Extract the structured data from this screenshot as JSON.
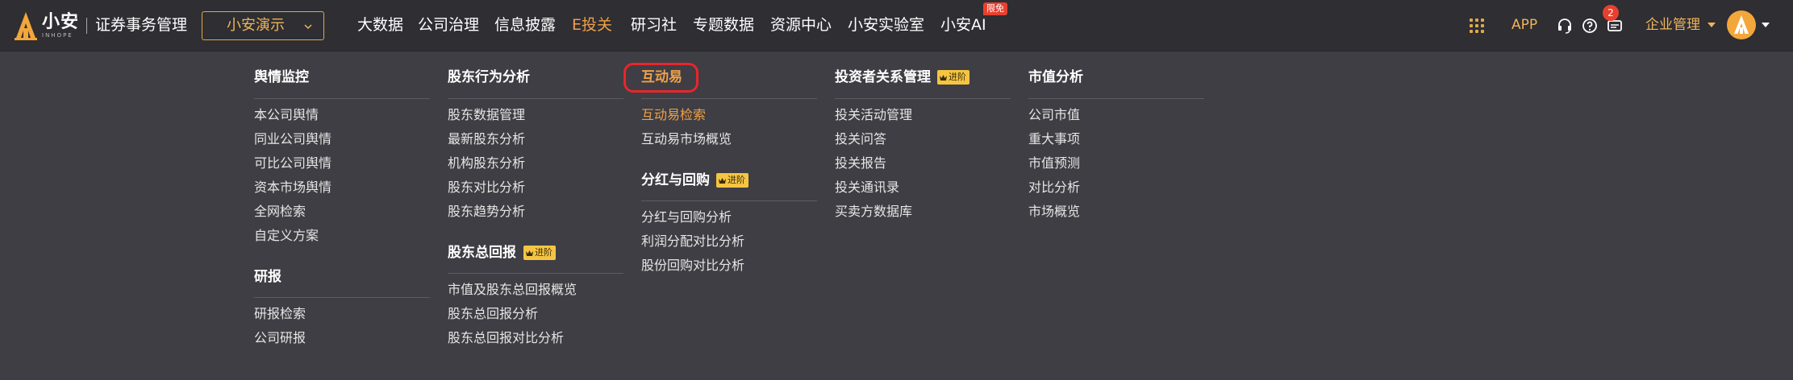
{
  "header": {
    "brand_cn": "小安",
    "brand_en": "INHOPE",
    "system_name": "证券事务管理",
    "company_select": "小安演示",
    "nav": [
      {
        "label": "大数据",
        "active": false
      },
      {
        "label": "公司治理",
        "active": false
      },
      {
        "label": "信息披露",
        "active": false
      },
      {
        "label": "E投关",
        "active": true
      },
      {
        "label": "研习社",
        "active": false
      },
      {
        "label": "专题数据",
        "active": false
      },
      {
        "label": "资源中心",
        "active": false
      },
      {
        "label": "小安实验室",
        "active": false
      },
      {
        "label": "小安AI",
        "active": false
      }
    ],
    "ai_badge": "限免",
    "app_label": "APP",
    "icons": [
      "apps-grid-icon",
      "headset-icon",
      "help-icon",
      "message-icon"
    ],
    "message_count": "2",
    "enterprise_label": "企业管理"
  },
  "menu": {
    "badge_label": "进阶",
    "col1": {
      "sections": [
        {
          "title": "舆情监控",
          "items": [
            "本公司舆情",
            "同业公司舆情",
            "可比公司舆情",
            "资本市场舆情",
            "全网检索",
            "自定义方案"
          ]
        },
        {
          "title": "研报",
          "items": [
            "研报检索",
            "公司研报"
          ]
        }
      ]
    },
    "col2": {
      "sections": [
        {
          "title": "股东行为分析",
          "items": [
            "股东数据管理",
            "最新股东分析",
            "机构股东分析",
            "股东对比分析",
            "股东趋势分析"
          ]
        },
        {
          "title": "股东总回报",
          "items": [
            "市值及股东总回报概览",
            "股东总回报分析",
            "股东总回报对比分析"
          ]
        }
      ]
    },
    "col3": {
      "sections": [
        {
          "title": "互动易",
          "items": [
            "互动易检索",
            "互动易市场概览"
          ]
        },
        {
          "title": "分红与回购",
          "items": [
            "分红与回购分析",
            "利润分配对比分析",
            "股份回购对比分析"
          ]
        }
      ]
    },
    "col4": {
      "sections": [
        {
          "title": "投资者关系管理",
          "items": [
            "投关活动管理",
            "投关问答",
            "投关报告",
            "投关通讯录",
            "买卖方数据库"
          ]
        }
      ]
    },
    "col5": {
      "sections": [
        {
          "title": "市值分析",
          "items": [
            "公司市值",
            "重大事项",
            "市值预测",
            "对比分析",
            "市场概览"
          ]
        }
      ]
    }
  },
  "colors": {
    "accent": "#f0a048",
    "badge_yellow": "#f5c542",
    "badge_red": "#e8402f",
    "highlight_ring": "#e8262a",
    "topbar_bg": "#2e2e33",
    "menu_bg": "#3e3e44"
  }
}
